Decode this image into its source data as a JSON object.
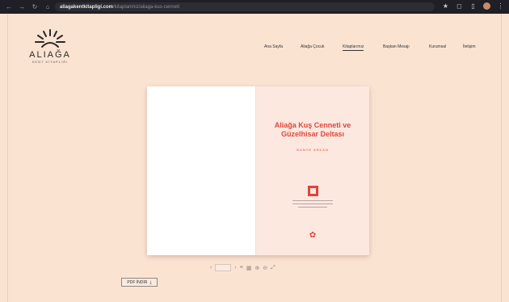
{
  "browser": {
    "url_host": "aliagakentkitapligi.com",
    "url_path": "/kitaplarimiz/aliaga-kus-cenneti"
  },
  "logo": {
    "title": "ALIAĞA",
    "subtitle": "KENT KİTAPLIĞI"
  },
  "menu": [
    {
      "label": "Ana Sayfa",
      "active": false
    },
    {
      "label": "Aliağa Çocuk",
      "active": false
    },
    {
      "label": "Kitaplarımız",
      "active": true
    },
    {
      "label": "Başkan Mesajı",
      "active": false
    },
    {
      "label": "Kurumsal",
      "active": false
    },
    {
      "label": "İletişim",
      "active": false
    }
  ],
  "book": {
    "title_line1": "Aliağa Kuş Cenneti ve",
    "title_line2": "Güzelhisar Deltası",
    "author": "BÜNYE ARKAN"
  },
  "toolbar": {
    "prev": "‹",
    "page_value": "",
    "next": "›",
    "icons": [
      "menu-icon",
      "grid-icon",
      "zoom-in-icon",
      "zoom-out-icon",
      "fullscreen-icon"
    ]
  },
  "pdf_button": {
    "label": "PDF İNDİR"
  },
  "colors": {
    "background": "#fbe3d2",
    "accent": "#e0453a",
    "chrome": "#1f2025"
  }
}
